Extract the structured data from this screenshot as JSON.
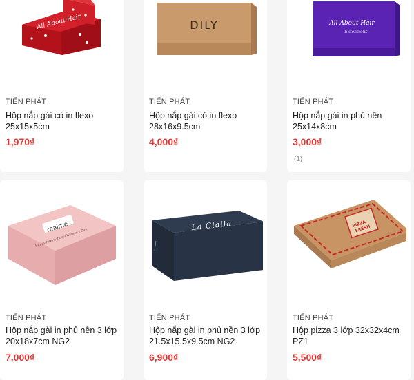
{
  "products": [
    {
      "seller": "TIẾN PHÁT",
      "title": "Hộp nắp gài có in flexo 25x15x5cm",
      "price": "1,970₫",
      "image": "red-christmas-box"
    },
    {
      "seller": "TIẾN PHÁT",
      "title": "Hộp nắp gài có in flexo 28x16x9.5cm",
      "price": "4,000₫",
      "image": "kraft-box",
      "brand": "DILY"
    },
    {
      "seller": "TIẾN PHÁT",
      "title": "Hộp nắp gài in phủ nền 25x14x8cm",
      "price": "3,000₫",
      "image": "purple-box",
      "brand": "All About Hair",
      "reviews": "(1)"
    },
    {
      "seller": "TIẾN PHÁT",
      "title": "Hộp nắp gài in phủ nền 3 lớp 20x18x7cm NG2",
      "price": "7,000₫",
      "image": "pink-box",
      "brand": "realme"
    },
    {
      "seller": "TIẾN PHÁT",
      "title": "Hộp nắp gài in phủ nền 3 lớp 21.5x15.5x9.5cm NG2",
      "price": "6,900₫",
      "image": "navy-box",
      "brand": "La Clalia"
    },
    {
      "seller": "TIẾN PHÁT",
      "title": "Hộp pizza 3 lớp 32x32x4cm PZ1",
      "price": "5,500₫",
      "image": "pizza-box"
    }
  ],
  "colors": {
    "price": "#e53935",
    "background": "#f5f5f5",
    "card": "#ffffff"
  }
}
